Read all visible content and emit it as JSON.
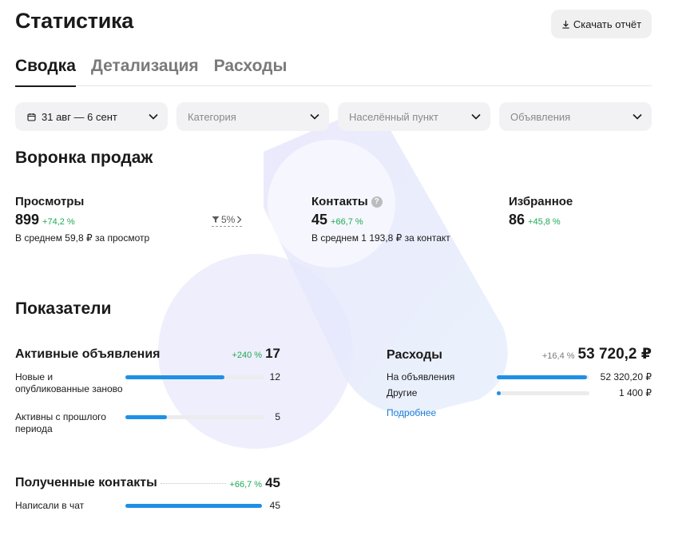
{
  "page": {
    "title": "Статистика",
    "download_label": "Скачать отчёт"
  },
  "tabs": [
    {
      "label": "Сводка",
      "active": true
    },
    {
      "label": "Детализация",
      "active": false
    },
    {
      "label": "Расходы",
      "active": false
    }
  ],
  "filters": {
    "date": "31 авг — 6 сент",
    "category_placeholder": "Категория",
    "location_placeholder": "Населённый пункт",
    "ads_placeholder": "Объявления"
  },
  "funnel": {
    "title": "Воронка продаж",
    "views": {
      "label": "Просмотры",
      "value": "899",
      "delta": "+74,2 %",
      "sub": "В среднем 59,8 ₽ за просмотр"
    },
    "conversion": "5%",
    "contacts": {
      "label": "Контакты",
      "value": "45",
      "delta": "+66,7 %",
      "sub": "В среднем 1 193,8 ₽ за контакт",
      "help": "?"
    },
    "favorites": {
      "label": "Избранное",
      "value": "86",
      "delta": "+45,8 %"
    }
  },
  "indicators": {
    "title": "Показатели",
    "active_ads": {
      "title": "Активные объявления",
      "delta": "+240 %",
      "total": "17",
      "rows": [
        {
          "label": "Новые и опубликованные заново",
          "value": "12",
          "fraction": 0.71
        },
        {
          "label": "Активны с прошлого периода",
          "value": "5",
          "fraction": 0.3
        }
      ]
    },
    "expenses": {
      "title": "Расходы",
      "delta": "+16,4 %",
      "total": "53 720,2 ₽",
      "rows": [
        {
          "label": "На объявления",
          "value": "52 320,20 ₽",
          "fraction": 0.97
        },
        {
          "label": "Другие",
          "value": "1 400 ₽",
          "fraction": 0.03
        }
      ],
      "more_label": "Подробнее"
    },
    "contacts_received": {
      "title": "Полученные контакты",
      "delta": "+66,7 %",
      "total": "45",
      "rows": [
        {
          "label": "Написали в чат",
          "value": "45",
          "fraction": 1.0
        }
      ]
    }
  },
  "colors": {
    "accent_bar": "#1e90e6",
    "positive": "#1faa55",
    "link": "#1e7fd6"
  }
}
